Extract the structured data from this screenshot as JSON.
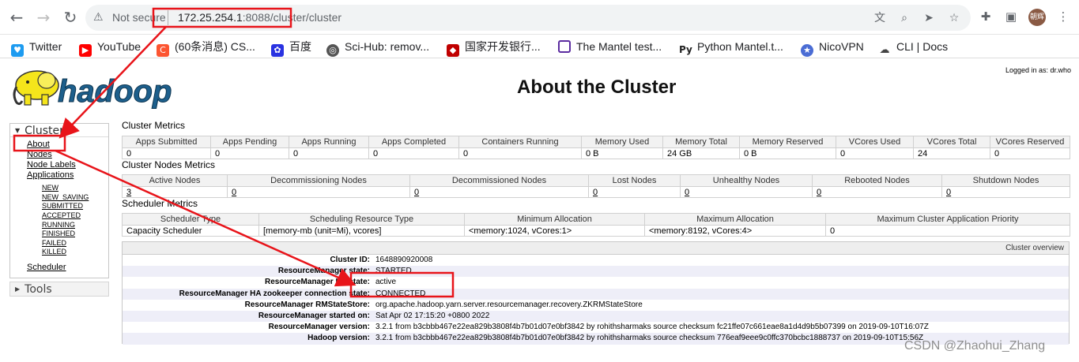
{
  "browser": {
    "security_label": "Not secure",
    "url_host": "172.25.254.1",
    "url_rest": ":8088/cluster/cluster",
    "avatar_text": "朝辉",
    "bookmarks": [
      {
        "label": "Twitter",
        "icon": "twitter-bird-icon",
        "color": "#1d9bf0"
      },
      {
        "label": "YouTube",
        "icon": "youtube-play-icon",
        "color": "#ff0000"
      },
      {
        "label": "(60条消息) CS...",
        "icon": "csdn-icon",
        "color": "#fc5531"
      },
      {
        "label": "百度",
        "icon": "baidu-paw-icon",
        "color": "#2932e1"
      },
      {
        "label": "Sci-Hub: remov...",
        "icon": "scihub-icon",
        "color": "#555555"
      },
      {
        "label": "国家开发银行...",
        "icon": "cdb-icon",
        "color": "#c00000"
      },
      {
        "label": "The Mantel test...",
        "icon": "page-icon",
        "color": "#5b2ca0"
      },
      {
        "label": "Python Mantel.t...",
        "icon": "py-icon",
        "color": "#222222"
      },
      {
        "label": "NicoVPN",
        "icon": "star-badge-icon",
        "color": "#4a6cd4"
      },
      {
        "label": "CLI | Docs",
        "icon": "cloud-icon",
        "color": "#444444"
      }
    ]
  },
  "page": {
    "logged_in": "Logged in as: dr.who",
    "title": "About the Cluster",
    "logo_text": "hadoop"
  },
  "sidebar": {
    "cluster_label": "Cluster",
    "links": [
      "About",
      "Nodes",
      "Node Labels",
      "Applications"
    ],
    "app_states": [
      "NEW",
      "NEW_SAVING",
      "SUBMITTED",
      "ACCEPTED",
      "RUNNING",
      "FINISHED",
      "FAILED",
      "KILLED"
    ],
    "scheduler_label": "Scheduler",
    "tools_label": "Tools"
  },
  "cluster_metrics": {
    "title": "Cluster Metrics",
    "headers": [
      "Apps Submitted",
      "Apps Pending",
      "Apps Running",
      "Apps Completed",
      "Containers Running",
      "Memory Used",
      "Memory Total",
      "Memory Reserved",
      "VCores Used",
      "VCores Total",
      "VCores Reserved"
    ],
    "values": [
      "0",
      "0",
      "0",
      "0",
      "0",
      "0 B",
      "24 GB",
      "0 B",
      "0",
      "24",
      "0"
    ]
  },
  "node_metrics": {
    "title": "Cluster Nodes Metrics",
    "headers": [
      "Active Nodes",
      "Decommissioning Nodes",
      "Decommissioned Nodes",
      "Lost Nodes",
      "Unhealthy Nodes",
      "Rebooted Nodes",
      "Shutdown Nodes"
    ],
    "values": [
      "3",
      "0",
      "0",
      "0",
      "0",
      "0",
      "0"
    ]
  },
  "scheduler_metrics": {
    "title": "Scheduler Metrics",
    "headers": [
      "Scheduler Type",
      "Scheduling Resource Type",
      "Minimum Allocation",
      "Maximum Allocation",
      "Maximum Cluster Application Priority"
    ],
    "values": [
      "Capacity Scheduler",
      "[memory-mb (unit=Mi), vcores]",
      "<memory:1024, vCores:1>",
      "<memory:8192, vCores:4>",
      "0"
    ]
  },
  "overview": {
    "title": "Cluster overview",
    "rows": [
      {
        "label": "Cluster ID:",
        "value": "1648890920008"
      },
      {
        "label": "ResourceManager state:",
        "value": "STARTED"
      },
      {
        "label": "ResourceManager HA state:",
        "value": "active"
      },
      {
        "label": "ResourceManager HA zookeeper connection state:",
        "value": "CONNECTED"
      },
      {
        "label": "ResourceManager RMStateStore:",
        "value": "org.apache.hadoop.yarn.server.resourcemanager.recovery.ZKRMStateStore"
      },
      {
        "label": "ResourceManager started on:",
        "value": "Sat Apr 02 17:15:20 +0800 2022"
      },
      {
        "label": "ResourceManager version:",
        "value": "3.2.1 from b3cbbb467e22ea829b3808f4b7b01d07e0bf3842 by rohithsharmaks source checksum fc21ffe07c661eae8a1d4d9b5b07399 on 2019-09-10T16:07Z"
      },
      {
        "label": "Hadoop version:",
        "value": "3.2.1 from b3cbbb467e22ea829b3808f4b7b01d07e0bf3842 by rohithsharmaks source checksum 776eaf9eee9c0ffc370bcbc1888737 on 2019-09-10T15:56Z"
      }
    ]
  },
  "watermark": "CSDN @Zhaohui_Zhang",
  "colors": {
    "annotation": "#e8141a",
    "logo_yellow": "#f5e51b",
    "logo_blue": "#1d5f8c"
  }
}
